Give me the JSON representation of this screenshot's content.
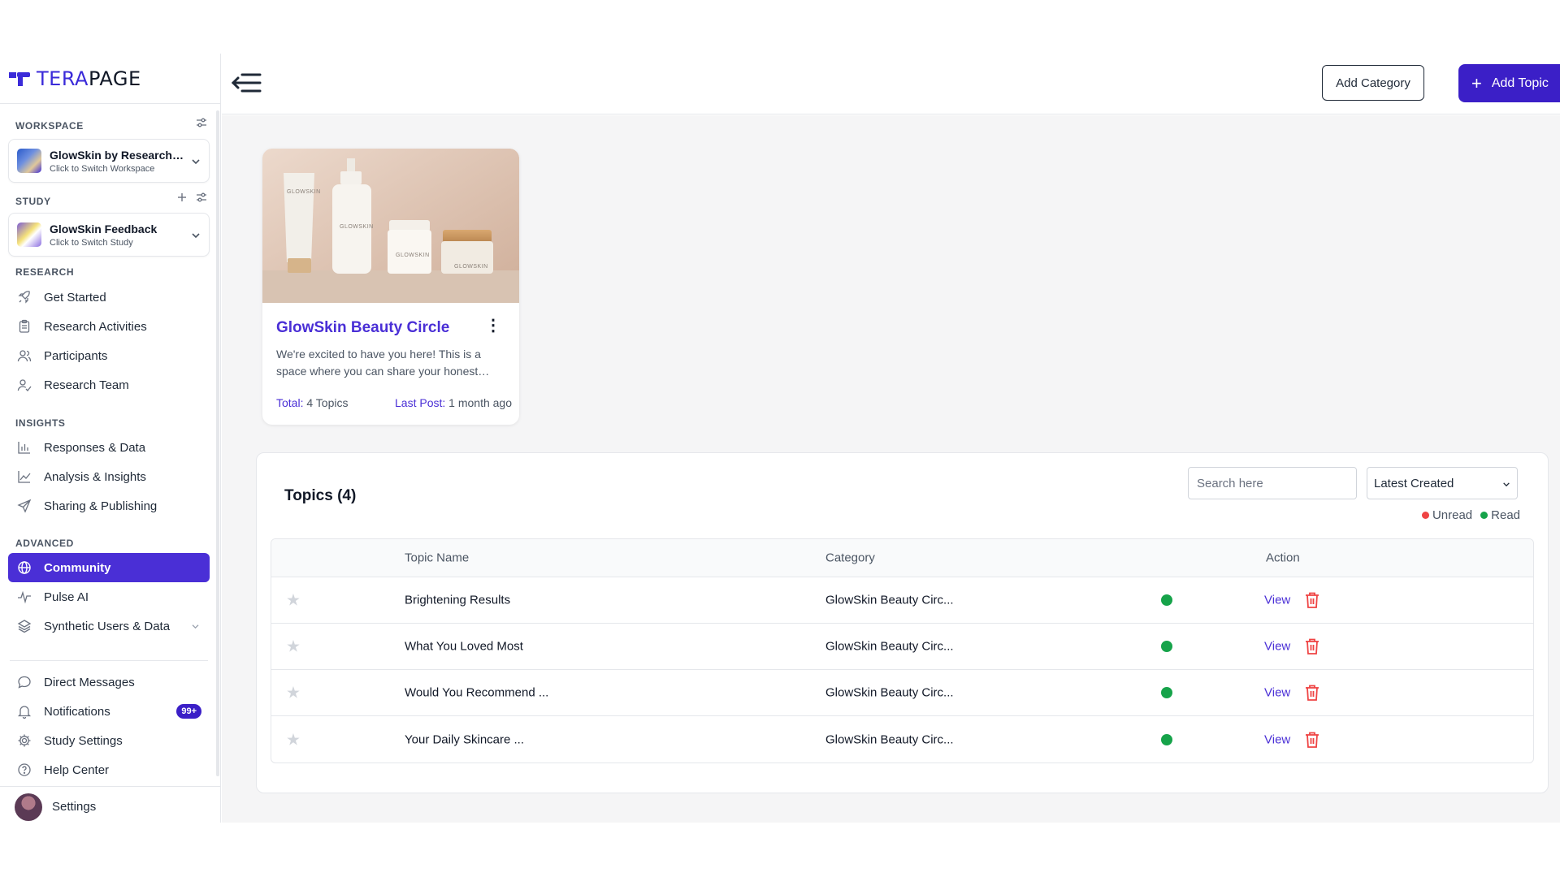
{
  "brand": {
    "name_part1": "TERA",
    "name_part2": "PAGE"
  },
  "sidebar": {
    "workspace": {
      "label": "WORKSPACE",
      "title": "GlowSkin by Research Team",
      "subtitle": "Click to Switch Workspace"
    },
    "study": {
      "label": "STUDY",
      "title": "GlowSkin Feedback",
      "subtitle": "Click to Switch Study"
    },
    "sections": {
      "research": "RESEARCH",
      "insights": "INSIGHTS",
      "advanced": "ADVANCED"
    },
    "research_items": [
      "Get Started",
      "Research Activities",
      "Participants",
      "Research Team"
    ],
    "insights_items": [
      "Responses & Data",
      "Analysis & Insights",
      "Sharing & Publishing"
    ],
    "advanced_items": [
      "Community",
      "Pulse AI",
      "Synthetic Users & Data"
    ],
    "bottom_items": [
      "Direct Messages",
      "Notifications",
      "Study Settings",
      "Help Center"
    ],
    "notifications_badge": "99+",
    "settings_label": "Settings"
  },
  "header": {
    "add_category": "Add Category",
    "add_topic": "Add Topic"
  },
  "category_card": {
    "title": "GlowSkin Beauty Circle",
    "description": "We're excited to have you here! This is a space where you can share your honest thoughts and experiences.",
    "total_label": "Total:",
    "total_value": "4 Topics",
    "last_post_label": "Last Post:",
    "last_post_value": "1 month ago",
    "product_labels": [
      "GLOWSKIN",
      "GLOWSKIN",
      "GLOWSKIN",
      "GLOWSKIN"
    ]
  },
  "topics": {
    "title": "Topics (4)",
    "search_placeholder": "Search here",
    "sort_value": "Latest Created",
    "legend_unread": "Unread",
    "legend_read": "Read",
    "columns": {
      "name": "Topic Name",
      "category": "Category",
      "action": "Action"
    },
    "view_label": "View",
    "rows": [
      {
        "name": "Brightening Results",
        "category": "GlowSkin Beauty Circ...",
        "status": "read"
      },
      {
        "name": "What You Loved Most",
        "category": "GlowSkin Beauty Circ...",
        "status": "read"
      },
      {
        "name": "Would You Recommend ...",
        "category": "GlowSkin Beauty Circ...",
        "status": "read"
      },
      {
        "name": "Your Daily Skincare ...",
        "category": "GlowSkin Beauty Circ...",
        "status": "read"
      }
    ]
  },
  "colors": {
    "accent": "#4a2fd6",
    "primary_button": "#3b1fc7",
    "read": "#16a34a",
    "unread": "#ef4444",
    "delete": "#ef4444"
  }
}
